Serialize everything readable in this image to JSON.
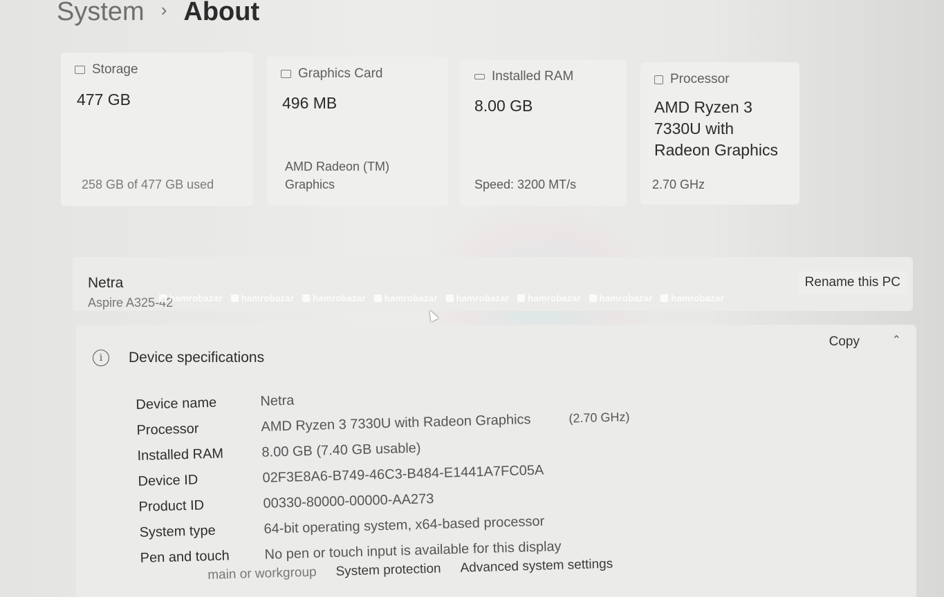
{
  "breadcrumb": {
    "parent": "System",
    "separator": "›",
    "current": "About"
  },
  "cards": {
    "storage": {
      "title": "Storage",
      "value": "477 GB",
      "sub": "258 GB of 477 GB used",
      "icon": "storage-icon"
    },
    "graphics": {
      "title": "Graphics Card",
      "value": "496 MB",
      "sub": "AMD Radeon (TM) Graphics",
      "icon": "graphics-card-icon"
    },
    "ram": {
      "title": "Installed RAM",
      "value": "8.00 GB",
      "sub": "Speed: 3200 MT/s",
      "icon": "ram-icon"
    },
    "processor": {
      "title": "Processor",
      "value": "AMD Ryzen 3 7330U with Radeon Graphics",
      "sub": "2.70 GHz",
      "icon": "processor-icon"
    }
  },
  "pc": {
    "name": "Netra",
    "model": "Aspire A325-42",
    "rename_label": "Rename this PC"
  },
  "watermark": {
    "text": "hamrobazar"
  },
  "specs": {
    "title": "Device specifications",
    "copy_label": "Copy",
    "rows": [
      {
        "label": "Device name",
        "value": "Netra"
      },
      {
        "label": "Processor",
        "value": "AMD Ryzen 3 7330U with Radeon Graphics",
        "extra": "(2.70 GHz)"
      },
      {
        "label": "Installed RAM",
        "value": "8.00 GB (7.40 GB usable)"
      },
      {
        "label": "Device ID",
        "value": "02F3E8A6-B749-46C3-B484-E1441A7FC05A"
      },
      {
        "label": "Product ID",
        "value": "00330-80000-00000-AA273"
      },
      {
        "label": "System type",
        "value": "64-bit operating system, x64-based processor"
      },
      {
        "label": "Pen and touch",
        "value": "No pen or touch input is available for this display"
      }
    ]
  },
  "related": {
    "domain_partial": "main or workgroup",
    "system_protection": "System protection",
    "advanced": "Advanced system settings"
  }
}
